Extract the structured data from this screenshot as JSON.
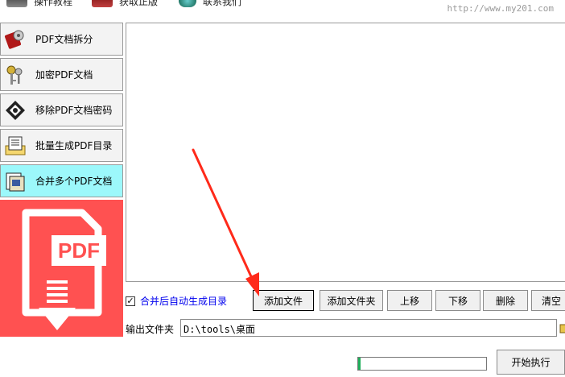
{
  "toolbar": {
    "items": [
      {
        "label": "操作教程",
        "icon": "book-icon"
      },
      {
        "label": "获取正版",
        "icon": "car-icon"
      },
      {
        "label": "联系我们",
        "icon": "globe-icon"
      }
    ],
    "url": "http://www.my201.com"
  },
  "sidebar": {
    "items": [
      {
        "label": "PDF文档拆分",
        "icon": "split-disc-icon"
      },
      {
        "label": "加密PDF文档",
        "icon": "keys-icon"
      },
      {
        "label": "移除PDF文档密码",
        "icon": "remove-lock-icon"
      },
      {
        "label": "批量生成PDF目录",
        "icon": "folder-list-icon"
      },
      {
        "label": "合并多个PDF文档",
        "icon": "merge-docs-icon",
        "active": true
      }
    ]
  },
  "pdf_graphic": {
    "text": "PDF",
    "color": "#ff5151"
  },
  "options": {
    "auto_toc_label": "合并后自动生成目录",
    "auto_toc_checked": true
  },
  "buttons": {
    "add_file": "添加文件",
    "add_folder": "添加文件夹",
    "move_up": "上移",
    "move_down": "下移",
    "delete": "删除",
    "clear": "清空"
  },
  "output": {
    "label": "输出文件夹",
    "path": "D:\\tools\\桌面"
  },
  "progress": {
    "value": 0.02
  },
  "start_button": "开始执行",
  "colors": {
    "accent_cyan": "#9cf8fb",
    "pdf_red": "#ff5151",
    "annotation_arrow": "#ff2a1a",
    "link_blue": "#0000ee"
  }
}
